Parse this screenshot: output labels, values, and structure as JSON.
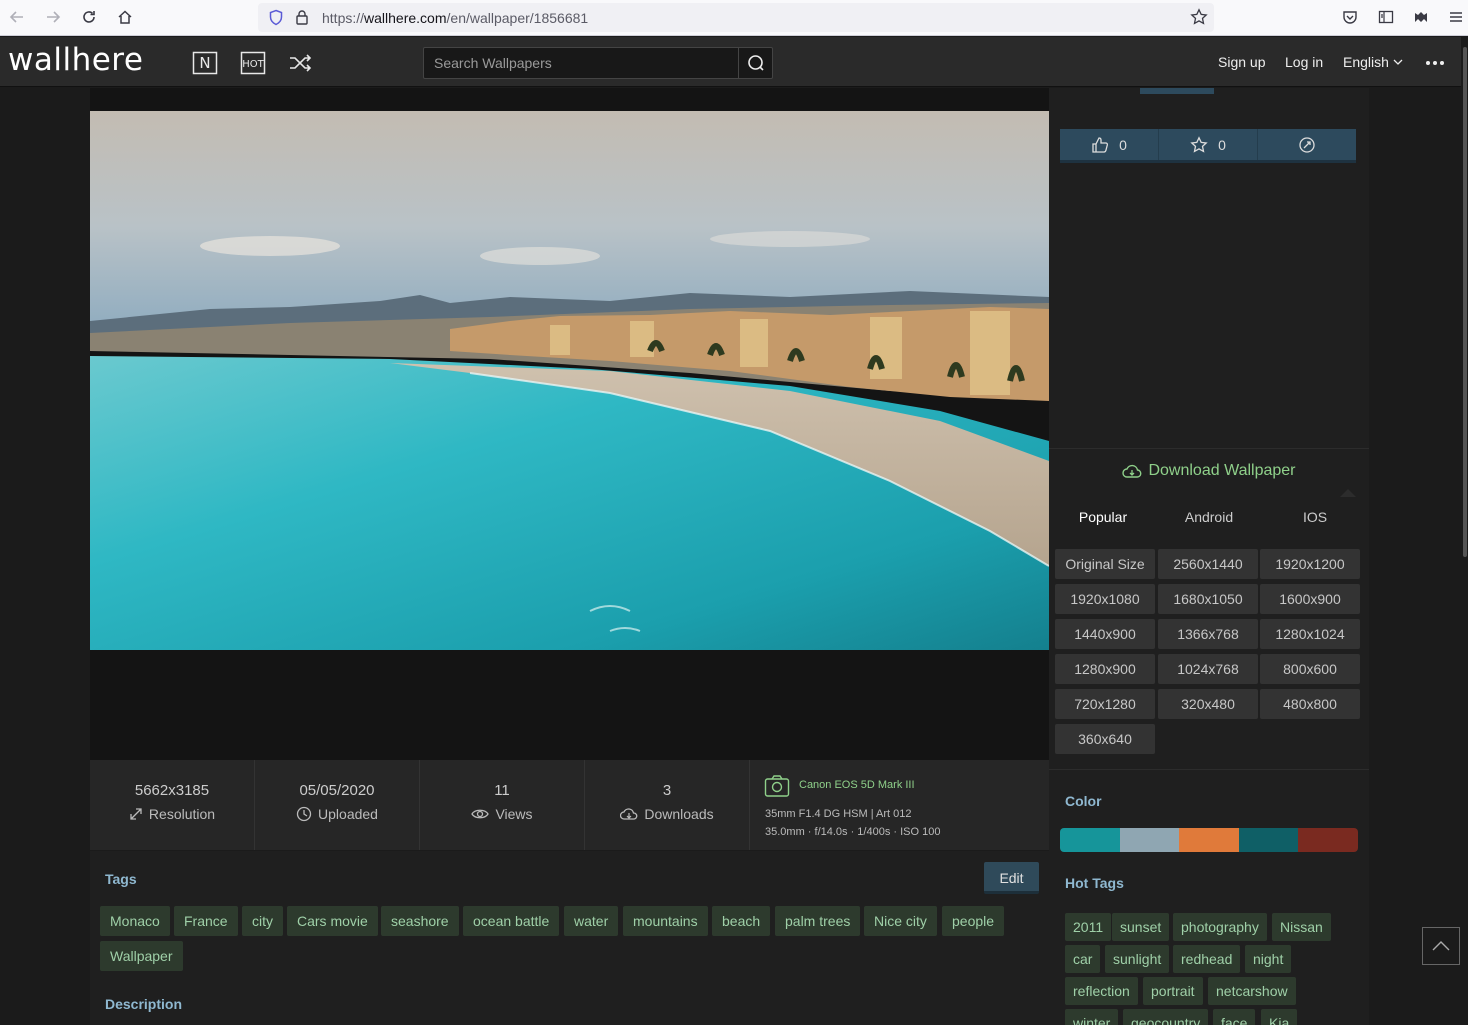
{
  "browser": {
    "url_prefix": "https://",
    "url_host": "wallhere.com",
    "url_path": "/en/wallpaper/1856681"
  },
  "header": {
    "logo": "wallhere",
    "new_icon": "N",
    "hot_icon": "HOT",
    "search_placeholder": "Search Wallpapers",
    "signup": "Sign up",
    "login": "Log in",
    "language": "English"
  },
  "stats": {
    "resolution_value": "5662x3185",
    "resolution_label": "Resolution",
    "uploaded_value": "05/05/2020",
    "uploaded_label": "Uploaded",
    "views_value": "11",
    "views_label": "Views",
    "downloads_value": "3",
    "downloads_label": "Downloads",
    "camera_model": "Canon EOS 5D Mark III",
    "lens": "35mm F1.4 DG HSM | Art 012",
    "exposure": "35.0mm · f/14.0s · 1/400s · ISO 100"
  },
  "tags": {
    "title": "Tags",
    "edit": "Edit",
    "items": [
      "Monaco",
      "France",
      "city",
      "Cars movie",
      "seashore",
      "ocean battle",
      "water",
      "mountains",
      "beach",
      "palm trees",
      "Nice city",
      "people",
      "Wallpaper"
    ]
  },
  "description_title": "Description",
  "actions": {
    "likes": "0",
    "favorites": "0"
  },
  "download": {
    "title": "Download Wallpaper",
    "tabs": [
      "Popular",
      "Android",
      "IOS"
    ],
    "sizes": [
      "Original Size",
      "2560x1440",
      "1920x1200",
      "1920x1080",
      "1680x1050",
      "1600x900",
      "1440x900",
      "1366x768",
      "1280x1024",
      "1280x900",
      "1024x768",
      "800x600",
      "720x1280",
      "320x480",
      "480x800",
      "360x640"
    ]
  },
  "color": {
    "title": "Color",
    "swatches": [
      "#16959a",
      "#8fa6b2",
      "#e07a3a",
      "#0f5f66",
      "#7a2a20"
    ]
  },
  "hot_tags": {
    "title": "Hot Tags",
    "items": [
      "2011",
      "sunset",
      "photography",
      "Nissan",
      "car",
      "sunlight",
      "redhead",
      "night",
      "reflection",
      "portrait",
      "netcarshow",
      "winter",
      "geocountry",
      "face",
      "Kia"
    ]
  }
}
